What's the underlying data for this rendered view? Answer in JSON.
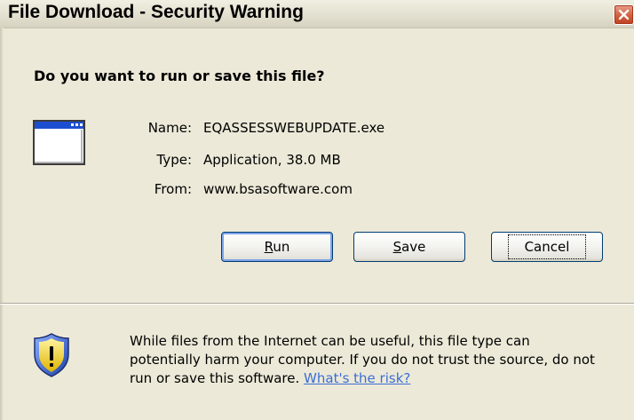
{
  "window": {
    "title": "File Download - Security Warning"
  },
  "dialog": {
    "question": "Do you want to run or save this file?",
    "icon": "application-window-icon",
    "fields": [
      {
        "label": "Name:",
        "value": "EQASSESSWEBUPDATE.exe"
      },
      {
        "label": "Type:",
        "value": "Application, 38.0 MB"
      },
      {
        "label": "From:",
        "value": "www.bsasoftware.com"
      }
    ],
    "buttons": {
      "run": {
        "mnemonic": "R",
        "rest": "un"
      },
      "save": {
        "mnemonic": "S",
        "rest": "ave"
      },
      "cancel": {
        "label": "Cancel"
      }
    }
  },
  "warning": {
    "icon": "security-shield-icon",
    "line1": "While files from the Internet can be useful, this file type can",
    "line2": "potentially harm your computer. If you do not trust the source, do not",
    "line3": "run or save this software.",
    "link": "What's the risk?"
  },
  "colors": {
    "link": "#3a6fd6",
    "background": "#ece9d8",
    "close_button": "#d0603f"
  }
}
